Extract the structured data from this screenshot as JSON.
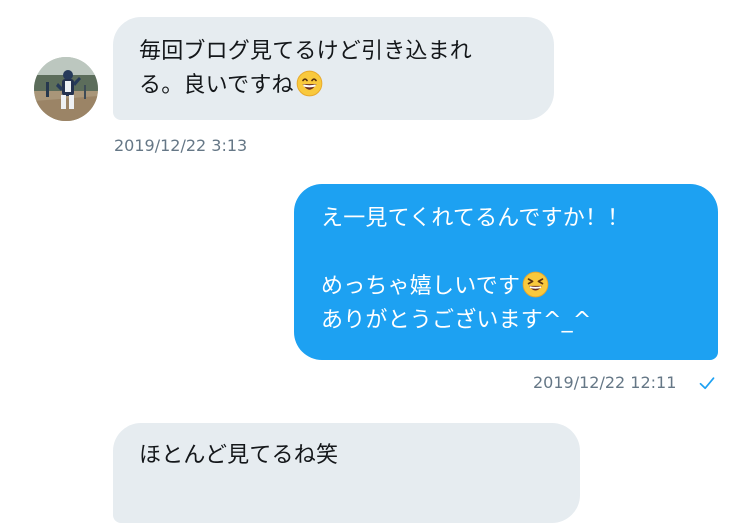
{
  "conversation": {
    "messages": [
      {
        "direction": "incoming",
        "lines": [
          "毎回ブログ見てるけど引き込まれ",
          "る。良いですね"
        ],
        "emoji": "grinning-squinting-face-icon",
        "timestamp": "2019/12/22 3:13"
      },
      {
        "direction": "outgoing",
        "lines": [
          "え一見てくれてるんですか！！",
          "",
          "めっちゃ嬉しいです",
          "ありがとうございます^_^"
        ],
        "emoji": "laughing-face-icon",
        "timestamp": "2019/12/22 12:11",
        "status_icon": "check-icon"
      },
      {
        "direction": "incoming",
        "lines": [
          "ほとんど見てるね笑"
        ]
      }
    ]
  },
  "colors": {
    "incoming_bubble": "#e6ecf0",
    "outgoing_bubble": "#1da1f2",
    "timestamp": "#657786",
    "check": "#1da1f2"
  }
}
